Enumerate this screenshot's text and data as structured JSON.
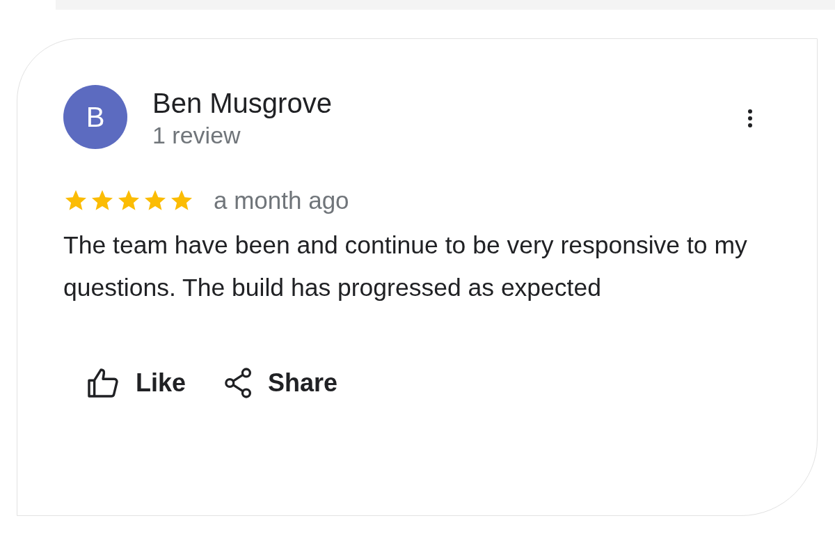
{
  "review": {
    "avatar_letter": "B",
    "author": "Ben Musgrove",
    "author_meta": "1 review",
    "stars": 5,
    "time": "a month ago",
    "text": "The team have been and continue to be very responsive to my questions. The build has progressed as expected",
    "actions": [
      {
        "kind": "like",
        "label": "Like"
      },
      {
        "kind": "share",
        "label": "Share"
      }
    ]
  }
}
